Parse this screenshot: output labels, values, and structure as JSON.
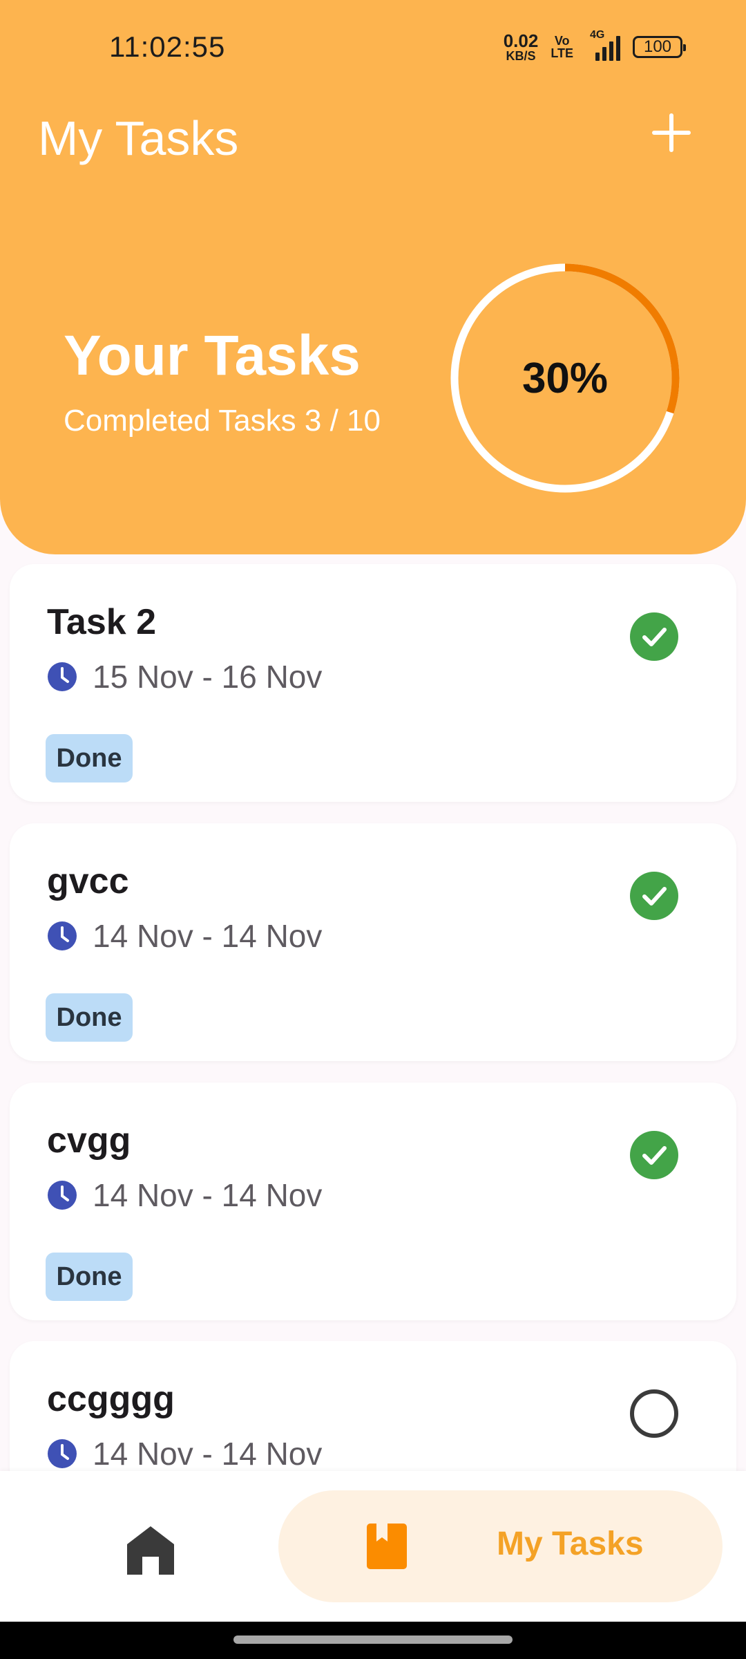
{
  "status_bar": {
    "time": "11:02:55",
    "net_speed_value": "0.02",
    "net_speed_unit": "KB/S",
    "volte_top": "Vo",
    "volte_bottom": "LTE",
    "network": "4G",
    "battery": "100"
  },
  "header": {
    "title": "My Tasks",
    "add_icon": "plus-icon"
  },
  "summary": {
    "title": "Your Tasks",
    "subtitle": "Completed Tasks 3 / 10",
    "progress_label": "30%",
    "progress_fraction": 0.3,
    "ring_color": "#ffffff",
    "progress_color": "#f07c00"
  },
  "tasks": [
    {
      "title": "Task 2",
      "dates": "15 Nov - 16 Nov",
      "status": "Done",
      "completed": true
    },
    {
      "title": "gvcc",
      "dates": "14 Nov - 14 Nov",
      "status": "Done",
      "completed": true
    },
    {
      "title": "cvgg",
      "dates": "14 Nov - 14 Nov",
      "status": "Done",
      "completed": true
    },
    {
      "title": "ccgggg",
      "dates": "14 Nov - 14 Nov",
      "status": "",
      "completed": false
    }
  ],
  "bottom_nav": {
    "home_icon": "home-icon",
    "tasks_icon": "bookmark-book-icon",
    "tasks_label": "My Tasks",
    "active_color": "#f4a226"
  },
  "colors": {
    "header": "#fdb44f",
    "done_check": "#43a448",
    "chip": "#bcdcf7",
    "clock": "#3f51b5"
  }
}
